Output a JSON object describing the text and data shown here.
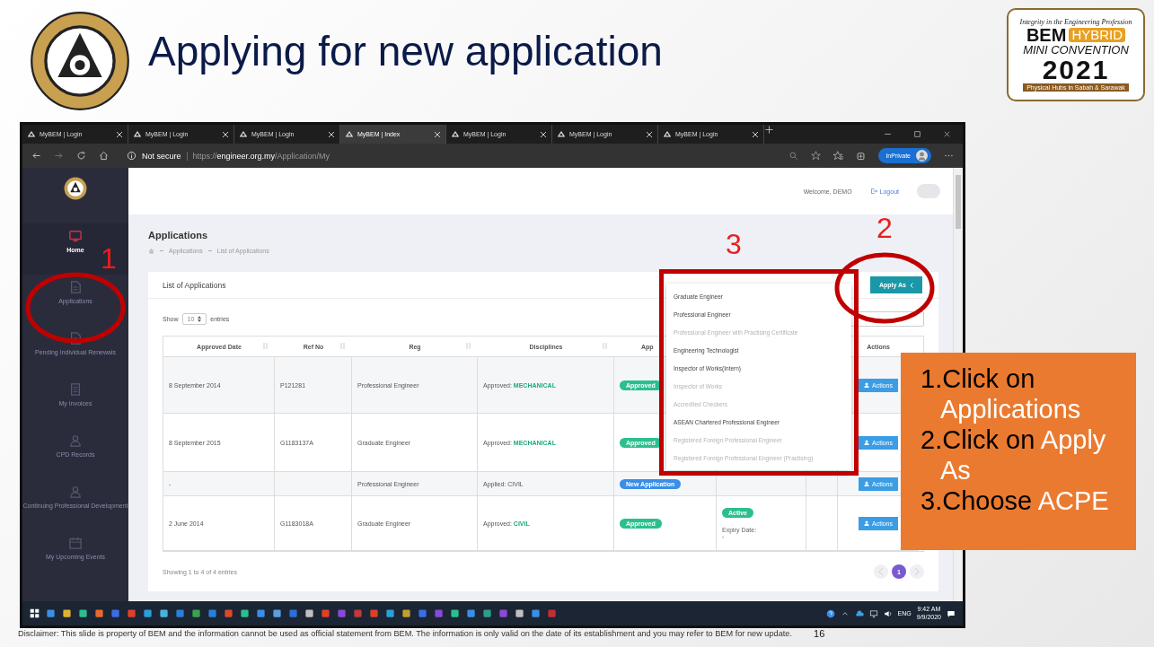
{
  "slide": {
    "title": "Applying for new application",
    "event_logo": {
      "tagline": "Integrity in the Engineering Profession",
      "brand": "BEM",
      "badge": "HYBRID",
      "name": "MINI CONVENTION",
      "year": "2021",
      "subtitle": "Physical Hubs in Sabah & Sarawak"
    },
    "disclaimer": "Disclaimer: This slide is property of BEM and the information cannot be used as official statement from BEM. The information is only valid on the date of its establishment and you may refer to BEM for new update.",
    "page_number": "16"
  },
  "browser": {
    "tabs": [
      {
        "title": "MyBEM | Login",
        "selected": false
      },
      {
        "title": "MyBEM | Login",
        "selected": false
      },
      {
        "title": "MyBEM | Login",
        "selected": false
      },
      {
        "title": "MyBEM | Index",
        "selected": true
      },
      {
        "title": "MyBEM | Login",
        "selected": false
      },
      {
        "title": "MyBEM | Login",
        "selected": false
      },
      {
        "title": "MyBEM | Login",
        "selected": false
      }
    ],
    "security": "Not secure",
    "url": "https://**engineer.org.my**/Application/My",
    "inprivate": "InPrivate"
  },
  "sidebar": {
    "items": [
      {
        "label": "Home",
        "selected": true
      },
      {
        "label": "Applications",
        "selected": false
      },
      {
        "label": "Pending Individual Renewals",
        "selected": false
      },
      {
        "label": "My Invoices",
        "selected": false
      },
      {
        "label": "CPD Records",
        "selected": false
      },
      {
        "label": "Continuing Professional Development",
        "selected": false
      },
      {
        "label": "My Upcoming Events",
        "selected": false
      }
    ]
  },
  "topbar": {
    "welcome": "Welcome, DEMO",
    "logout": "Logout"
  },
  "page": {
    "title": "Applications",
    "breadcrumb": [
      "Applications",
      "List of Applications"
    ]
  },
  "card": {
    "title": "List of Applications",
    "apply_button": "Apply As",
    "show": "Show",
    "page_size": "10",
    "entries": "entries",
    "columns": [
      "Approved Date",
      "Ref No",
      "Reg",
      "Disciplines",
      "App",
      "Actions"
    ],
    "rows": [
      {
        "approved_date": "8 September 2014",
        "ref_no": "P121281",
        "reg": "Professional Engineer",
        "disciplines": "Approved: **MECHANICAL**",
        "status": {
          "label": "Approved",
          "kind": "approved"
        },
        "action": "Actions"
      },
      {
        "approved_date": "8 September 2015",
        "ref_no": "G1183137A",
        "reg": "Graduate Engineer",
        "disciplines": "Approved: **MECHANICAL**",
        "status": {
          "label": "Approved",
          "kind": "approved"
        },
        "action": "Actions"
      },
      {
        "approved_date": "-",
        "reg": "Professional Engineer",
        "disciplines": "Applied: CIVIL",
        "status": {
          "label": "New Application",
          "kind": "new"
        },
        "action": "Actions"
      },
      {
        "approved_date": "2 June 2014",
        "ref_no": "G1183018A",
        "reg": "Graduate Engineer",
        "disciplines": "Approved: **CIVIL**",
        "status": {
          "label": "Approved",
          "kind": "approved"
        },
        "column_6": {
          "badge": "Active",
          "label": "Expiry Date:",
          "value": "-"
        },
        "action": "Actions"
      }
    ],
    "info": "Showing 1 to 4 of 4 entries",
    "pages": [
      {
        "label": "1",
        "selected": true
      }
    ]
  },
  "apply_menu": {
    "items": [
      {
        "label": "Graduate Engineer",
        "disabled": false
      },
      {
        "label": "Professional Engineer",
        "disabled": false
      },
      {
        "label": "Professional Engineer with Practising Certificate",
        "disabled": true
      },
      {
        "label": "Engineering Technologist",
        "disabled": false
      },
      {
        "label": "Inspector of Works(Intern)",
        "disabled": false
      },
      {
        "label": "Inspector of Works",
        "disabled": true
      },
      {
        "label": "Accredited Checkers",
        "disabled": true
      },
      {
        "label": "ASEAN Chartered Professional Engineer",
        "disabled": false
      },
      {
        "label": "Registered Foreign Professional Engineer",
        "disabled": true
      },
      {
        "label": "Registered Foreign Professional Engineer (Practising)",
        "disabled": true
      }
    ]
  },
  "annotations": [
    "1",
    "3",
    "2"
  ],
  "steps": [
    {
      "lead": "1.Click on",
      "highlight": "Applications"
    },
    {
      "lead": "2.Click on",
      "highlight": "Apply As"
    },
    {
      "lead": "3.Choose",
      "highlight": "ACPE"
    }
  ],
  "taskbar": {
    "language": "ENG",
    "time": "9:42 AM",
    "date": "9/9/2020"
  }
}
